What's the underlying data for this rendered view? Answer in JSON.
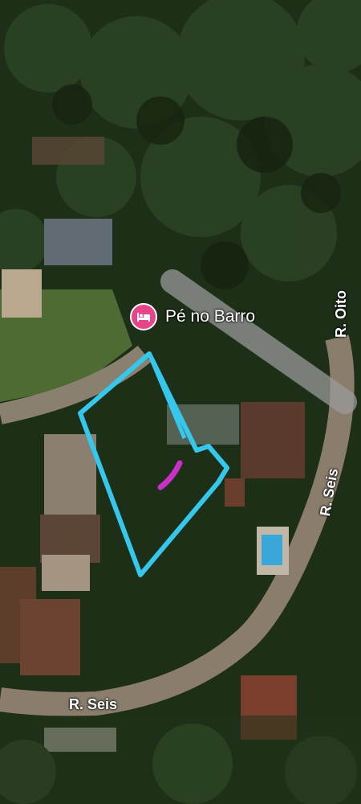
{
  "poi": {
    "label": "Pé no Barro",
    "icon": "hotel-bed-icon",
    "color": "#e8448a"
  },
  "streets": [
    {
      "label": "R. Oito"
    },
    {
      "label": "R. Seis"
    },
    {
      "label": "R. Seis"
    }
  ],
  "colors": {
    "plot_outline": "#35c8ec",
    "mark": "#c930c9",
    "road": "#8a8070"
  }
}
